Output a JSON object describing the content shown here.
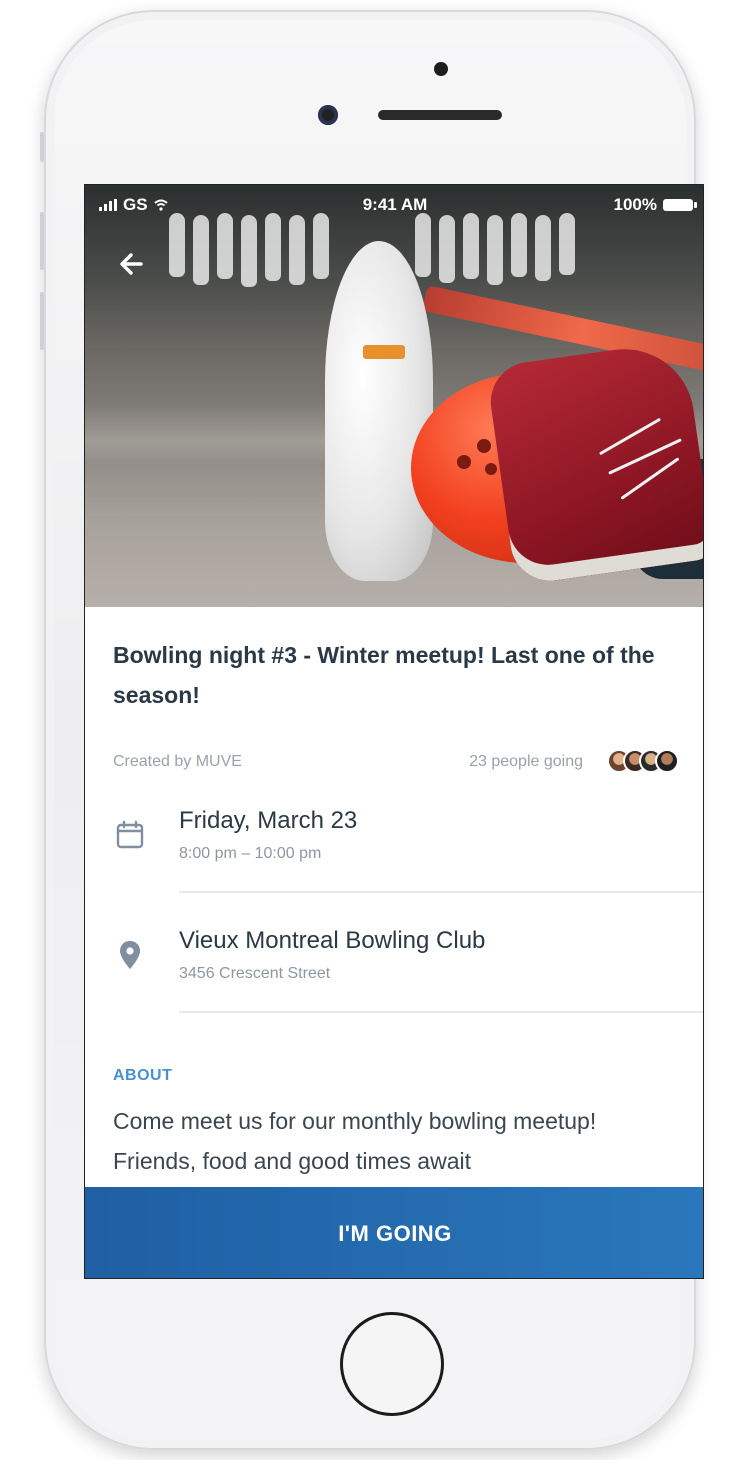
{
  "status_bar": {
    "carrier": "GS",
    "time": "9:41 AM",
    "battery": "100%"
  },
  "event": {
    "title": "Bowling night #3 - Winter meetup! Last one of the season!",
    "created_by": "Created by MUVE",
    "attendees_text": "23 people going",
    "date": "Friday, March 23",
    "time_range": "8:00 pm – 10:00 pm",
    "venue": "Vieux Montreal Bowling Club",
    "address": "3456 Crescent Street",
    "about_label": "ABOUT",
    "about_text": "Come meet us for our monthly bowling meetup! Friends, food and good times await"
  },
  "cta": {
    "label": "I'M GOING"
  },
  "colors": {
    "accent_blue": "#2a77bc",
    "title_text": "#2a3946",
    "muted_text": "#9aa1a8",
    "section_label": "#4a8fd1"
  },
  "icons": [
    "back-arrow-icon",
    "calendar-icon",
    "location-pin-icon",
    "signal-icon",
    "wifi-icon",
    "battery-icon"
  ]
}
